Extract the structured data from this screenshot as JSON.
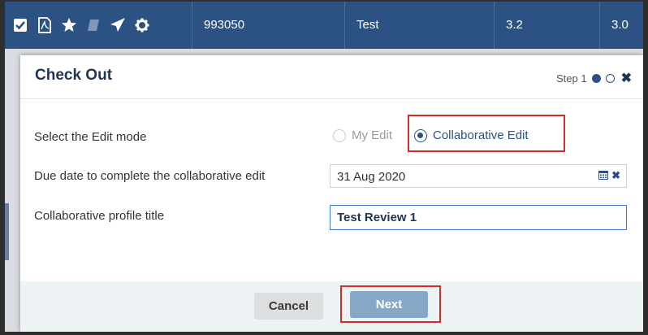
{
  "background_row": {
    "icons": [
      "checkbox-icon",
      "pdf-icon",
      "star-icon",
      "book-icon",
      "paper-plane-icon",
      "gear-icon"
    ],
    "cells": [
      "993050",
      "Test",
      "3.2",
      "3.0"
    ]
  },
  "modal": {
    "title": "Check Out",
    "step_label": "Step 1",
    "form": {
      "edit_mode_label": "Select the Edit mode",
      "edit_mode_options": [
        "My Edit",
        "Collaborative Edit"
      ],
      "edit_mode_selected": "Collaborative Edit",
      "due_date_label": "Due date to complete the collaborative edit",
      "due_date_value": "31 Aug 2020",
      "profile_title_label": "Collaborative profile title",
      "profile_title_value": "Test Review 1"
    },
    "buttons": {
      "cancel": "Cancel",
      "next": "Next"
    }
  },
  "colors": {
    "header_blue": "#2c5283",
    "highlight_red": "#d42b2b",
    "next_button": "#85a7c8"
  }
}
